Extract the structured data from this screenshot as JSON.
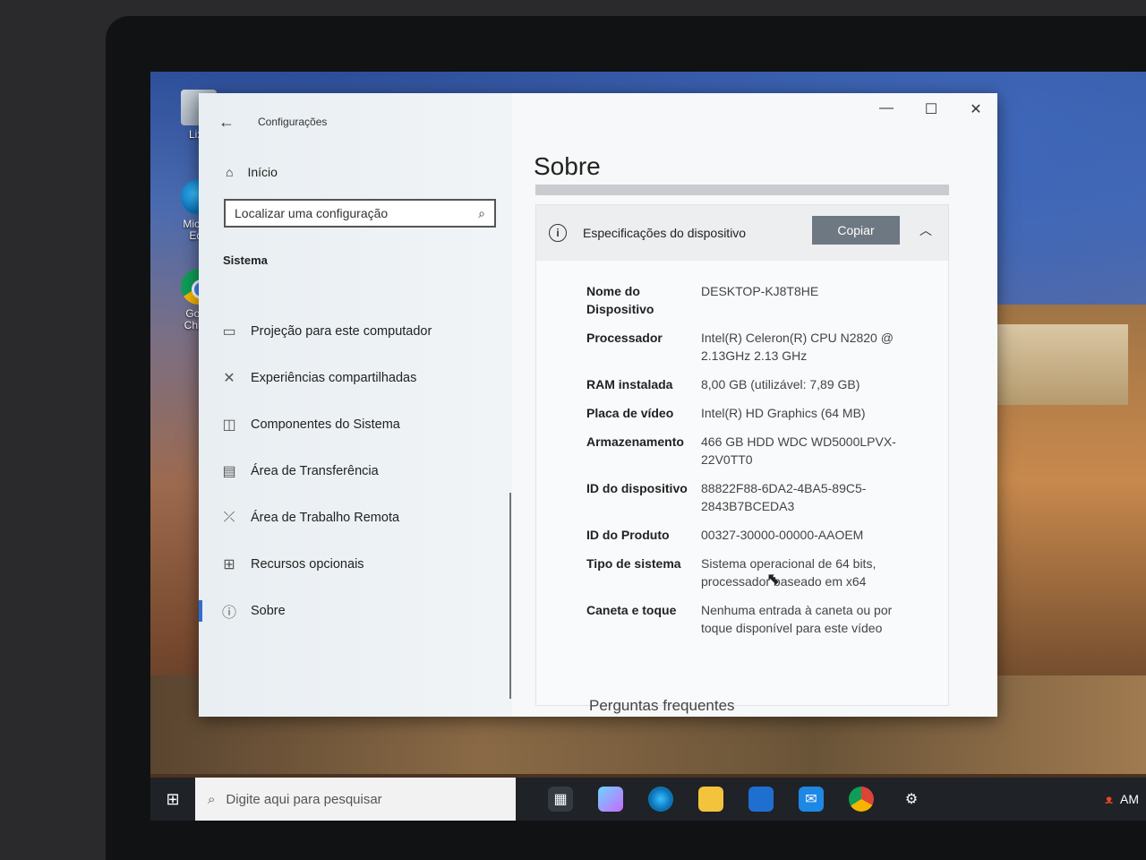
{
  "desktop": {
    "icons": [
      {
        "label": "Lixe"
      },
      {
        "label": "Micros Edg"
      },
      {
        "label": "Goog Chron"
      }
    ]
  },
  "window": {
    "app_title": "Configurações",
    "home_label": "Início",
    "search_placeholder": "Localizar uma configuração",
    "section_label": "Sistema",
    "nav_items": [
      {
        "label": "Projeção para este computador",
        "icon": "projector-icon"
      },
      {
        "label": "Experiências compartilhadas",
        "icon": "share-icon"
      },
      {
        "label": "Componentes do Sistema",
        "icon": "components-icon"
      },
      {
        "label": "Área de Transferência",
        "icon": "clipboard-icon"
      },
      {
        "label": "Área de Trabalho Remota",
        "icon": "remote-desktop-icon"
      },
      {
        "label": "Recursos opcionais",
        "icon": "grid-add-icon"
      },
      {
        "label": "Sobre",
        "icon": "info-icon",
        "active": true
      }
    ],
    "controls": {
      "minimize": "—",
      "maximize": "☐",
      "close": "✕"
    }
  },
  "main": {
    "page_title": "Sobre",
    "card": {
      "title": "Especificações do dispositivo",
      "copy_label": "Copiar",
      "specs": [
        {
          "label": "Nome do Dispositivo",
          "value": "DESKTOP-KJ8T8HE"
        },
        {
          "label": "Processador",
          "value": "Intel(R) Celeron(R) CPU N2820 @ 2.13GHz 2.13 GHz"
        },
        {
          "label": "RAM instalada",
          "value": "8,00 GB (utilizável: 7,89 GB)"
        },
        {
          "label": "Placa de vídeo",
          "value": "Intel(R) HD Graphics (64 MB)"
        },
        {
          "label": "Armazenamento",
          "value": "466 GB HDD WDC WD5000LPVX-22V0TT0"
        },
        {
          "label": "ID do dispositivo",
          "value": "88822F88-6DA2-4BA5-89C5-2843B7BCEDA3"
        },
        {
          "label": "ID do Produto",
          "value": "00327-30000-00000-AAOEM"
        },
        {
          "label": "Tipo de sistema",
          "value": "Sistema operacional de 64 bits, processador baseado em x64"
        },
        {
          "label": "Caneta e toque",
          "value": "Nenhuma entrada à caneta ou por toque disponível para este vídeo"
        }
      ]
    },
    "faq_label": "Perguntas frequentes"
  },
  "taskbar": {
    "search_placeholder": "Digite aqui para pesquisar",
    "tray_text": "AM"
  }
}
